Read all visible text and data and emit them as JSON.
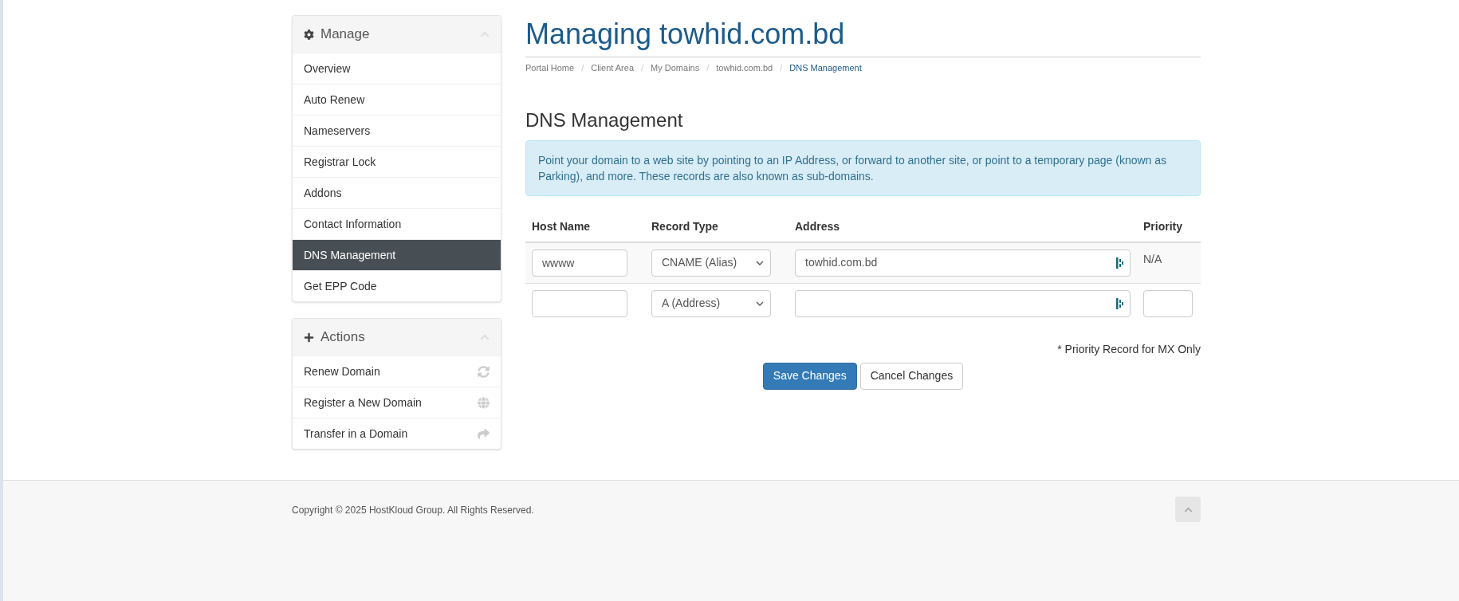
{
  "sidebar": {
    "panels": [
      {
        "kind": "manage",
        "title": "Manage",
        "expanded": true,
        "items": [
          {
            "label": "Overview",
            "selected": false
          },
          {
            "label": "Auto Renew",
            "selected": false
          },
          {
            "label": "Nameservers",
            "selected": false
          },
          {
            "label": "Registrar Lock",
            "selected": false
          },
          {
            "label": "Addons",
            "selected": false
          },
          {
            "label": "Contact Information",
            "selected": false
          },
          {
            "label": "DNS Management",
            "selected": true
          },
          {
            "label": "Get EPP Code",
            "selected": false
          }
        ]
      },
      {
        "kind": "actions",
        "title": "Actions",
        "expanded": true,
        "items": [
          {
            "label": "Renew Domain",
            "selected": false
          },
          {
            "label": "Register a New Domain",
            "selected": false
          },
          {
            "label": "Transfer in a Domain",
            "selected": false
          }
        ]
      }
    ]
  },
  "page": {
    "title": "Managing towhid.com.bd",
    "breadcrumb_separator": "/",
    "breadcrumb": [
      {
        "label": "Portal Home",
        "selected": false
      },
      {
        "label": "Client Area",
        "selected": false
      },
      {
        "label": "My Domains",
        "selected": false
      },
      {
        "label": "towhid.com.bd",
        "selected": false
      },
      {
        "label": "DNS Management",
        "selected": true
      }
    ],
    "section_title": "DNS Management",
    "info": "Point your domain to a web site by pointing to an IP Address, or forward to another site, or point to a temporary page (known as Parking), and more. These records are also known as sub-domains.",
    "table": {
      "columns": [
        "Host Name",
        "Record Type",
        "Address",
        "Priority"
      ],
      "rows": [
        {
          "host": "wwww",
          "type": "CNAME (Alias)",
          "address": "towhid.com.bd",
          "priority": {
            "kind": "text",
            "value": "N/A"
          }
        },
        {
          "type": "A (Address)",
          "priority": {
            "kind": "input"
          }
        }
      ]
    },
    "note": "* Priority Record for MX Only",
    "buttons": [
      {
        "label": "Save Changes",
        "kind": "primary"
      },
      {
        "label": "Cancel Changes",
        "kind": "default"
      }
    ]
  },
  "footer": {
    "copyright": "Copyright © 2025 HostKloud Group. All Rights Reserved."
  }
}
